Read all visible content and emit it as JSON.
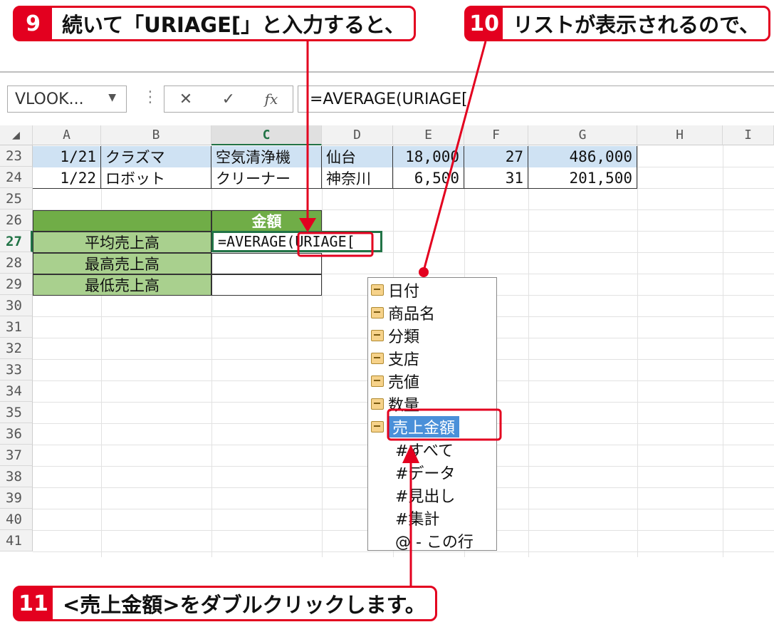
{
  "callouts": [
    {
      "num": "9",
      "text": "続いて「URIAGE[」と入力すると、"
    },
    {
      "num": "10",
      "text": "リストが表示されるので、"
    },
    {
      "num": "11",
      "text": "<売上金額>をダブルクリックします。"
    }
  ],
  "namebox": {
    "value": "VLOOK...",
    "dropdown": "▼"
  },
  "fx_buttons": {
    "cancel": "✕",
    "enter": "✓",
    "fx": "fx"
  },
  "formula_bar": {
    "value": "=AVERAGE(URIAGE["
  },
  "columns": [
    "A",
    "B",
    "C",
    "D",
    "E",
    "F",
    "G",
    "H",
    "I"
  ],
  "rows": [
    "23",
    "24",
    "25",
    "26",
    "27",
    "28",
    "29",
    "30",
    "31",
    "32",
    "33",
    "34",
    "35",
    "36",
    "37",
    "38",
    "39",
    "40",
    "41"
  ],
  "data_rows": [
    {
      "date": "1/21",
      "product": "クラズマ",
      "category": "空気清浄機",
      "branch": "仙台",
      "price": "18,000",
      "qty": "27",
      "amount": "486,000"
    },
    {
      "date": "1/22",
      "product": "ロボット",
      "category": "クリーナー",
      "branch": "神奈川",
      "price": "6,500",
      "qty": "31",
      "amount": "201,500"
    }
  ],
  "summary": {
    "header": "金額",
    "labels": [
      "平均売上高",
      "最高売上高",
      "最低売上高"
    ],
    "active_input": "=AVERAGE(URIAGE["
  },
  "autocomplete": {
    "items": [
      "日付",
      "商品名",
      "分類",
      "支店",
      "売値",
      "数量",
      "売上金額",
      "#すべて",
      "#データ",
      "#見出し",
      "#集計",
      "@ - この行"
    ],
    "selected": "売上金額"
  },
  "colors": {
    "accent": "#e3001f",
    "header_fill": "#70ad47",
    "label_fill": "#a9d08e",
    "row_fill": "#cfe2f3",
    "selected": "#4a90d9"
  }
}
